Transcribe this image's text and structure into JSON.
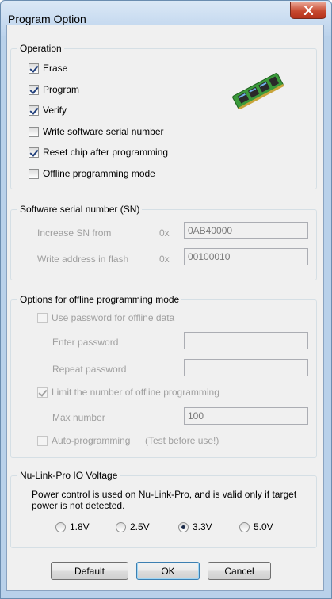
{
  "window": {
    "title": "Program Option"
  },
  "operation": {
    "legend": "Operation",
    "items": [
      {
        "label": "Erase",
        "checked": true
      },
      {
        "label": "Program",
        "checked": true
      },
      {
        "label": "Verify",
        "checked": true
      },
      {
        "label": "Write software serial number",
        "checked": false
      },
      {
        "label": "Reset chip after programming",
        "checked": true
      },
      {
        "label": "Offline programming mode",
        "checked": false
      }
    ],
    "icon": "memory-chip-icon"
  },
  "serial": {
    "legend": "Software serial number (SN)",
    "increase_label": "Increase SN from",
    "increase_prefix": "0x",
    "increase_value": "0AB40000",
    "address_label": "Write address in flash",
    "address_prefix": "0x",
    "address_value": "00100010"
  },
  "offline": {
    "legend": "Options for offline programming mode",
    "use_password_label": "Use password for offline data",
    "enter_password_label": "Enter password",
    "repeat_password_label": "Repeat password",
    "limit_label": "Limit the number of offline programming",
    "max_number_label": "Max number",
    "max_number_value": "100",
    "auto_programming_label": "Auto-programming",
    "auto_programming_note": "(Test before use!)"
  },
  "voltage": {
    "legend": "Nu-Link-Pro IO Voltage",
    "description": "Power control is used on Nu-Link-Pro, and is valid only if target power is not detected.",
    "options": [
      "1.8V",
      "2.5V",
      "3.3V",
      "5.0V"
    ],
    "selected": "3.3V"
  },
  "buttons": {
    "default_label": "Default",
    "ok_label": "OK",
    "cancel_label": "Cancel"
  }
}
